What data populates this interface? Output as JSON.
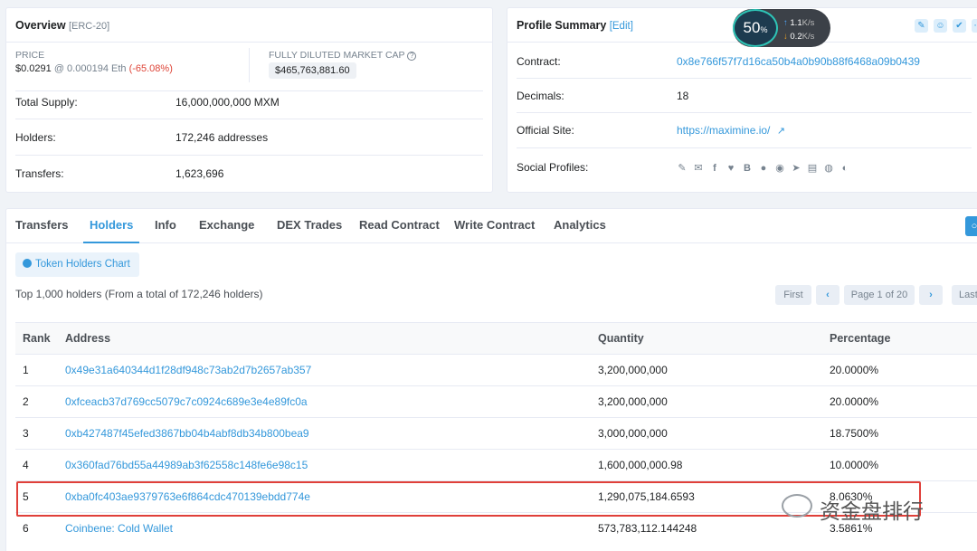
{
  "overview": {
    "title": "Overview",
    "token_type": "[ERC-20]",
    "price_label": "PRICE",
    "price_usd": "$0.0291",
    "price_eth": "@ 0.000194 Eth",
    "price_change": "(-65.08%)",
    "mcap_label": "FULLY DILUTED MARKET CAP",
    "mcap_value": "$465,763,881.60",
    "rows": [
      {
        "label": "Total Supply:",
        "value": "16,000,000,000 MXM"
      },
      {
        "label": "Holders:",
        "value": "172,246 addresses"
      },
      {
        "label": "Transfers:",
        "value": "1,623,696"
      }
    ]
  },
  "profile": {
    "title": "Profile Summary",
    "edit": "[Edit]",
    "rows": [
      {
        "label": "Contract:",
        "value": "0x8e766f57f7d16ca50b4a0b90b88f6468a09b0439"
      },
      {
        "label": "Decimals:",
        "value": "18"
      },
      {
        "label": "Official Site:",
        "value": "https://maximine.io/"
      },
      {
        "label": "Social Profiles:",
        "value": ""
      }
    ],
    "social_icons": [
      "pencil-icon",
      "email-icon",
      "facebook-icon",
      "twitter-icon",
      "bitcointalk-icon",
      "github-icon",
      "reddit-icon",
      "telegram-icon",
      "whitepaper-icon",
      "wechat-icon",
      "coinmarketcap-icon"
    ]
  },
  "speed_widget": {
    "percent": "50",
    "percent_sign": "%",
    "up": "1.1",
    "down": "0.2",
    "unit": "K/s"
  },
  "tabs": [
    "Transfers",
    "Holders",
    "Info",
    "Exchange",
    "DEX Trades",
    "Read Contract",
    "Write Contract",
    "Analytics"
  ],
  "active_tab": "Holders",
  "holders": {
    "chart_button": "Token Holders Chart",
    "summary": "Top 1,000 holders (From a total of 172,246 holders)",
    "pager": {
      "first": "First",
      "page": "Page 1 of 20",
      "last": "Last"
    },
    "columns": [
      "Rank",
      "Address",
      "Quantity",
      "Percentage"
    ],
    "rows": [
      {
        "rank": "1",
        "address": "0x49e31a640344d1f28df948c73ab2d7b2657ab357",
        "quantity": "3,200,000,000",
        "percentage": "20.0000%"
      },
      {
        "rank": "2",
        "address": "0xfceacb37d769cc5079c7c0924c689e3e4e89fc0a",
        "quantity": "3,200,000,000",
        "percentage": "20.0000%"
      },
      {
        "rank": "3",
        "address": "0xb427487f45efed3867bb04b4abf8db34b800bea9",
        "quantity": "3,000,000,000",
        "percentage": "18.7500%"
      },
      {
        "rank": "4",
        "address": "0x360fad76bd55a44989ab3f62558c148fe6e98c15",
        "quantity": "1,600,000,000.98",
        "percentage": "10.0000%"
      },
      {
        "rank": "5",
        "address": "0xba0fc403ae9379763e6f864cdc470139ebdd774e",
        "quantity": "1,290,075,184.6593",
        "percentage": "8.0630%"
      },
      {
        "rank": "6",
        "address": "Coinbene: Cold Wallet",
        "quantity": "573,783,112.144248",
        "percentage": "3.5861%"
      }
    ]
  },
  "watermark": "资金盘排行",
  "colors": {
    "accent": "#3498db",
    "negative": "#de4437",
    "highlight_box": "#e0403a"
  }
}
